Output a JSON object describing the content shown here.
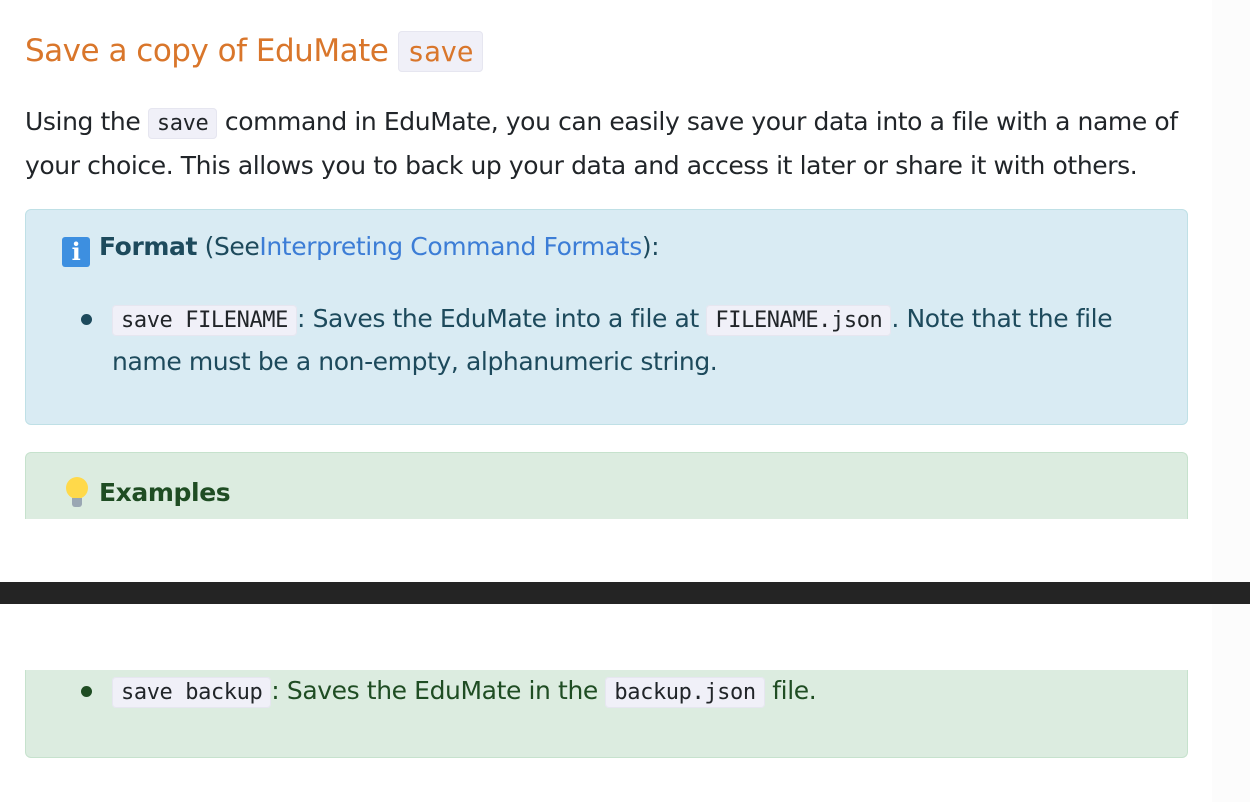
{
  "heading": {
    "text": "Save a copy of EduMate",
    "code": "save"
  },
  "intro": {
    "before": "Using the",
    "code": "save",
    "after": "command in EduMate, you can easily save your data into a file with a name of your choice. This allows you to back up your data and access it later or share it with others."
  },
  "format_box": {
    "icon": "info-icon",
    "label": "Format",
    "see_prefix": "(See",
    "link_text": "Interpreting Command Formats",
    "see_suffix": "):",
    "items": [
      {
        "code": "save FILENAME",
        "text_a": ": Saves the EduMate into a file at",
        "code2": "FILENAME.json",
        "text_b": ". Note that the file name must be a non-empty, alphanumeric string."
      }
    ]
  },
  "examples_box": {
    "icon": "lightbulb-icon",
    "label": "Examples",
    "items": [
      {
        "code": "save backup",
        "text_a": ": Saves the EduMate in the",
        "code2": "backup.json",
        "text_b": "file."
      }
    ]
  },
  "colors": {
    "heading": "#d9762b",
    "info_bg": "#d9ebf3",
    "info_text": "#1d4a5c",
    "link": "#3c7dd6",
    "example_bg": "#dcece0",
    "example_text": "#1f4d23",
    "dark_bar": "#242424"
  }
}
